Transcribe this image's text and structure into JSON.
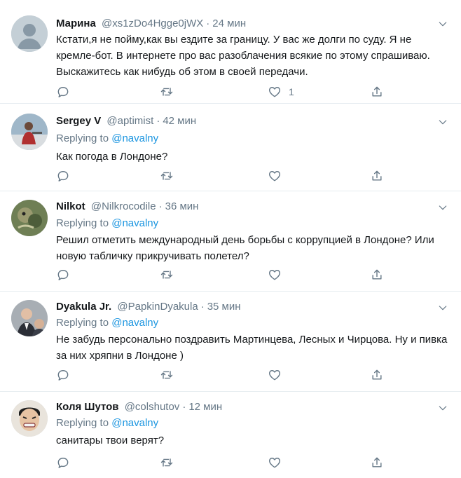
{
  "tweets": [
    {
      "name": "Марина",
      "handle": "@xs1zDo4Hgge0jWX",
      "sep": "·",
      "time": "24 мин",
      "replying": "",
      "mention": "",
      "text": "Кстати,я не пойму,как вы ездите за границу. У вас же долги по суду. Я не кремле-бот. В интернете про вас разоблачения всякие по этому спрашиваю. Выскажитесь как нибудь об этом в своей передачи.",
      "like_count": "1",
      "avatar": "default-avatar"
    },
    {
      "name": "Sergey V",
      "handle": "@aptimist",
      "sep": "·",
      "time": "42 мин",
      "replying": "Replying to",
      "mention": "@navalny",
      "text": "Как погода в Лондоне?",
      "like_count": "",
      "avatar": "photo-avatar"
    },
    {
      "name": "Nilkot",
      "handle": "@Nilkrocodile",
      "sep": "·",
      "time": "36 мин",
      "replying": "Replying to",
      "mention": "@navalny",
      "text": "Решил отметить международный день борьбы с коррупцией в Лондоне? Или новую табличку прикручивать полетел?",
      "like_count": "",
      "avatar": "photo-avatar"
    },
    {
      "name": "Dyakula Jr.",
      "handle": "@PapkinDyakula",
      "sep": "·",
      "time": "35 мин",
      "replying": "Replying to",
      "mention": "@navalny",
      "text": "Не забудь персонально поздравить Мартинцева, Лесных и  Чирцова. Ну и пивка за них хряпни в Лондоне )",
      "like_count": "",
      "avatar": "photo-avatar"
    },
    {
      "name": "Коля Шутов",
      "handle": "@colshutov",
      "sep": "·",
      "time": "12 мин",
      "replying": "Replying to",
      "mention": "@navalny",
      "text": "санитары твои верят?",
      "like_count": "",
      "avatar": "photo-avatar"
    }
  ],
  "icons": {
    "reply": "reply-icon",
    "retweet": "retweet-icon",
    "like": "heart-icon",
    "share": "share-icon",
    "menu": "chevron-down-icon"
  },
  "colors": {
    "link": "#1b95e0",
    "muted": "#657786",
    "text": "#14171a",
    "divider": "#e6ecf0"
  }
}
